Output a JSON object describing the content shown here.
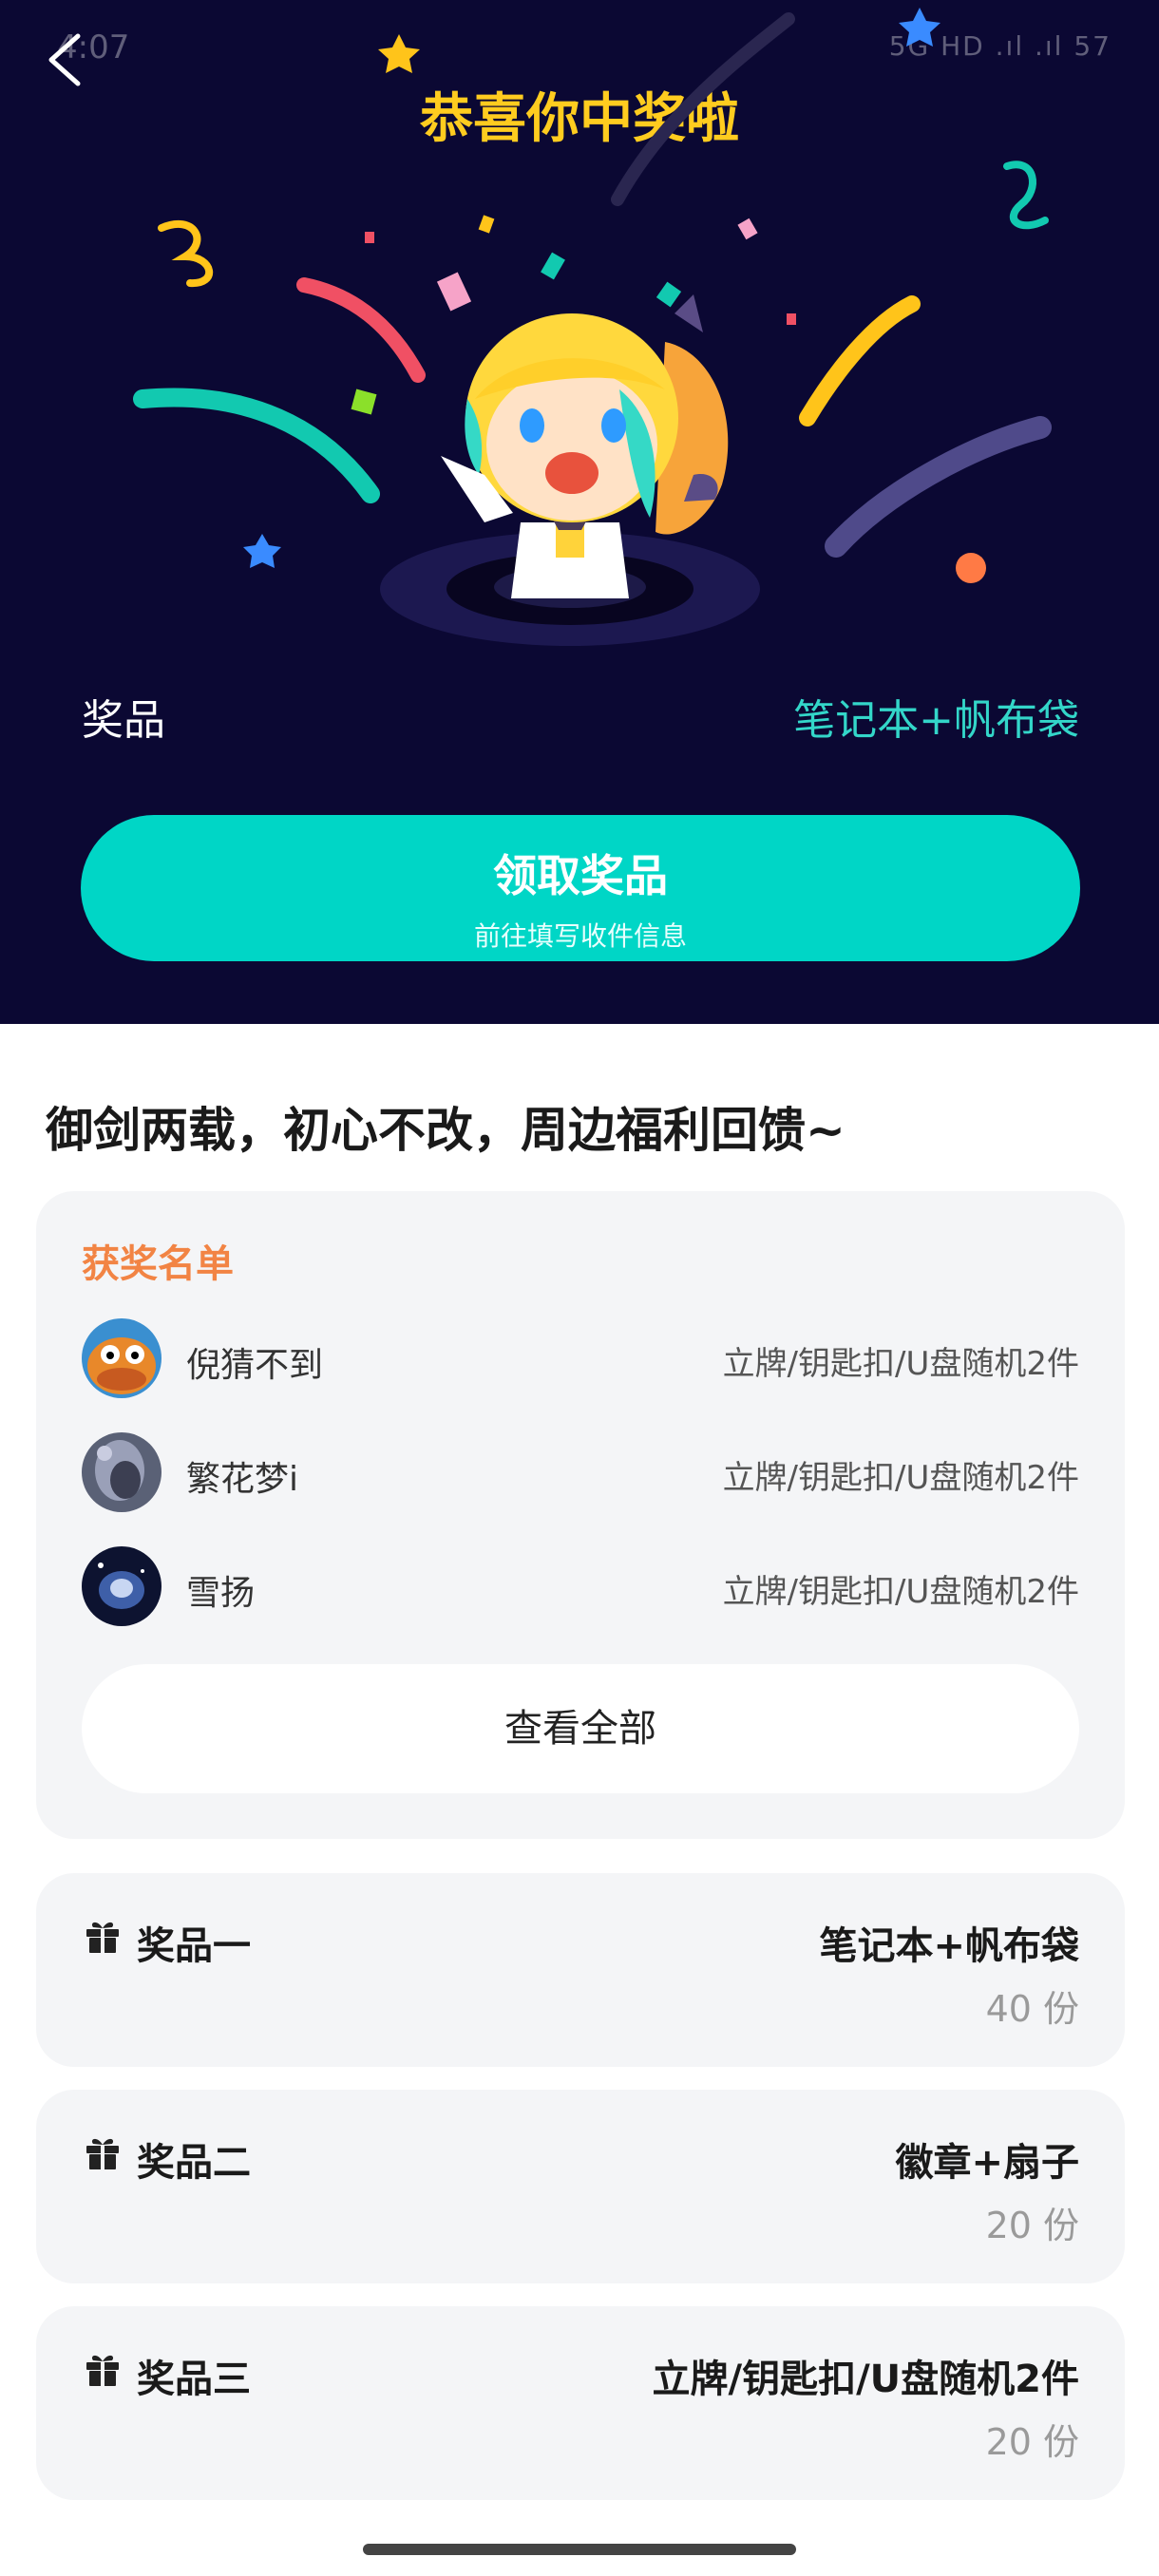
{
  "status_bar": {
    "time": "4:07",
    "right": "5G  HD  .ıl  .ıl  57"
  },
  "hero": {
    "title": "恭喜你中奖啦",
    "prize_label": "奖品",
    "prize_value": "笔记本+帆布袋",
    "claim_button": {
      "title": "领取奖品",
      "subtitle": "前往填写收件信息"
    }
  },
  "section_heading": "御剑两载，初心不改，周边福利回馈~",
  "winners": {
    "title": "获奖名单",
    "rows": [
      {
        "name": "倪猜不到",
        "prize": "立牌/钥匙扣/U盘随机2件"
      },
      {
        "name": "繁花梦i",
        "prize": "立牌/钥匙扣/U盘随机2件"
      },
      {
        "name": "雪扬",
        "prize": "立牌/钥匙扣/U盘随机2件"
      }
    ],
    "view_all": "查看全部"
  },
  "prizes": [
    {
      "label": "奖品一",
      "name": "笔记本+帆布袋",
      "count": "40 份"
    },
    {
      "label": "奖品二",
      "name": "徽章+扇子",
      "count": "20 份"
    },
    {
      "label": "奖品三",
      "name": "立牌/钥匙扣/U盘随机2件",
      "count": "20 份"
    }
  ],
  "colors": {
    "hero_bg": "#0b0833",
    "title_yellow": "#ffcc1f",
    "accent_teal": "#00d6c6",
    "winners_title_orange": "#f28444",
    "card_bg": "#f4f5f7"
  },
  "icons": {
    "back": "chevron-left-icon",
    "gift": "gift-icon"
  }
}
